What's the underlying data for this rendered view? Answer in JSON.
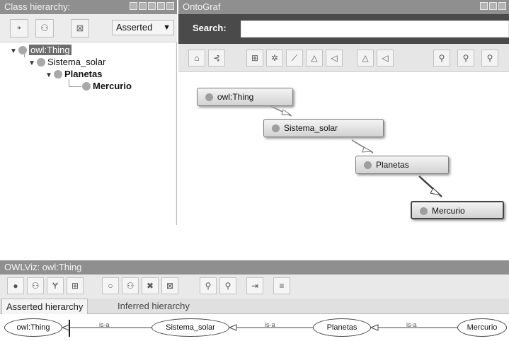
{
  "class_hierarchy": {
    "title": "Class hierarchy:",
    "mode_select": "Asserted",
    "toolbar": [
      {
        "name": "add-subclass-icon",
        "glyph": "⁍"
      },
      {
        "name": "add-sibling-icon",
        "glyph": "⚇"
      },
      {
        "name": "delete-class-icon",
        "glyph": "⊠"
      }
    ],
    "tree": [
      {
        "label": "owl:Thing",
        "depth": 0,
        "selected": true
      },
      {
        "label": "Sistema_solar",
        "depth": 1
      },
      {
        "label": "Planetas",
        "depth": 2,
        "bold": true
      },
      {
        "label": "Mercurio",
        "depth": 3,
        "bold": true
      }
    ]
  },
  "ontograf": {
    "title": "OntoGraf",
    "search_label": "Search:",
    "search_value": "",
    "toolbar_icons": [
      "home-icon",
      "flow-icon",
      "grid-icon",
      "radial-icon",
      "spring-icon",
      "tree-down-icon",
      "tree-left-icon",
      "tree-up-icon",
      "tree-right-icon",
      "zoom-in-icon",
      "zoom-out-icon",
      "zoom-fit-icon"
    ],
    "nodes": [
      "owl:Thing",
      "Sistema_solar",
      "Planetas",
      "Mercurio"
    ]
  },
  "owlviz": {
    "title": "OWLViz: owl:Thing",
    "tabs": [
      "Asserted hierarchy",
      "Inferred hierarchy"
    ],
    "toolbar_icons": [
      "class-icon",
      "subclass-icon",
      "superclass-icon",
      "grid-icon",
      "circle-icon",
      "tree-icon",
      "collapse-icon",
      "fit-icon",
      "zoom-out-icon",
      "zoom-in-icon",
      "export-icon",
      "options-icon"
    ],
    "nodes": [
      "owl:Thing",
      "Sistema_solar",
      "Planetas",
      "Mercurio"
    ],
    "edge_label": "is-a"
  }
}
